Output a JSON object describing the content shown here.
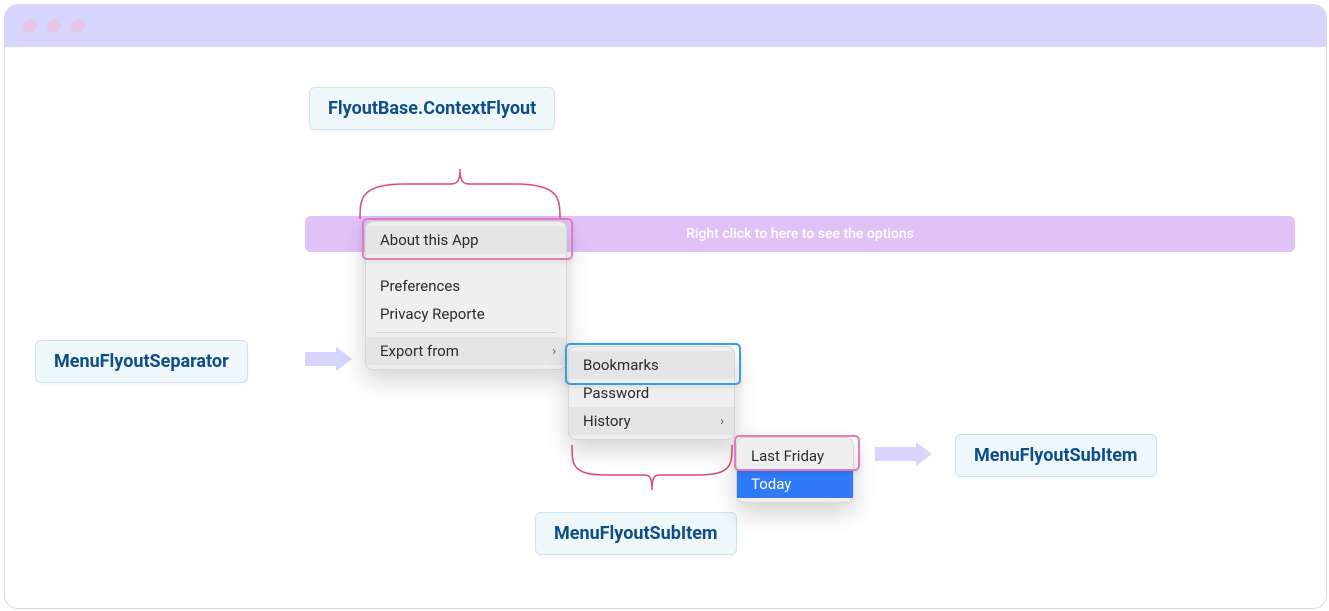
{
  "hintbar": {
    "text": "Right click to here to see the options"
  },
  "labels": {
    "context_flyout": "FlyoutBase.ContextFlyout",
    "separator": "MenuFlyoutSeparator",
    "subitem_bottom": "MenuFlyoutSubItem",
    "subitem_right": "MenuFlyoutSubItem"
  },
  "menu1": {
    "about": "About this App",
    "prefs": "Preferences",
    "privacy": "Privacy Reporte",
    "export": "Export from"
  },
  "menu2": {
    "bookmarks": "Bookmarks",
    "password": "Password",
    "history": "History"
  },
  "menu3": {
    "lastfriday": "Last Friday",
    "today": "Today"
  }
}
